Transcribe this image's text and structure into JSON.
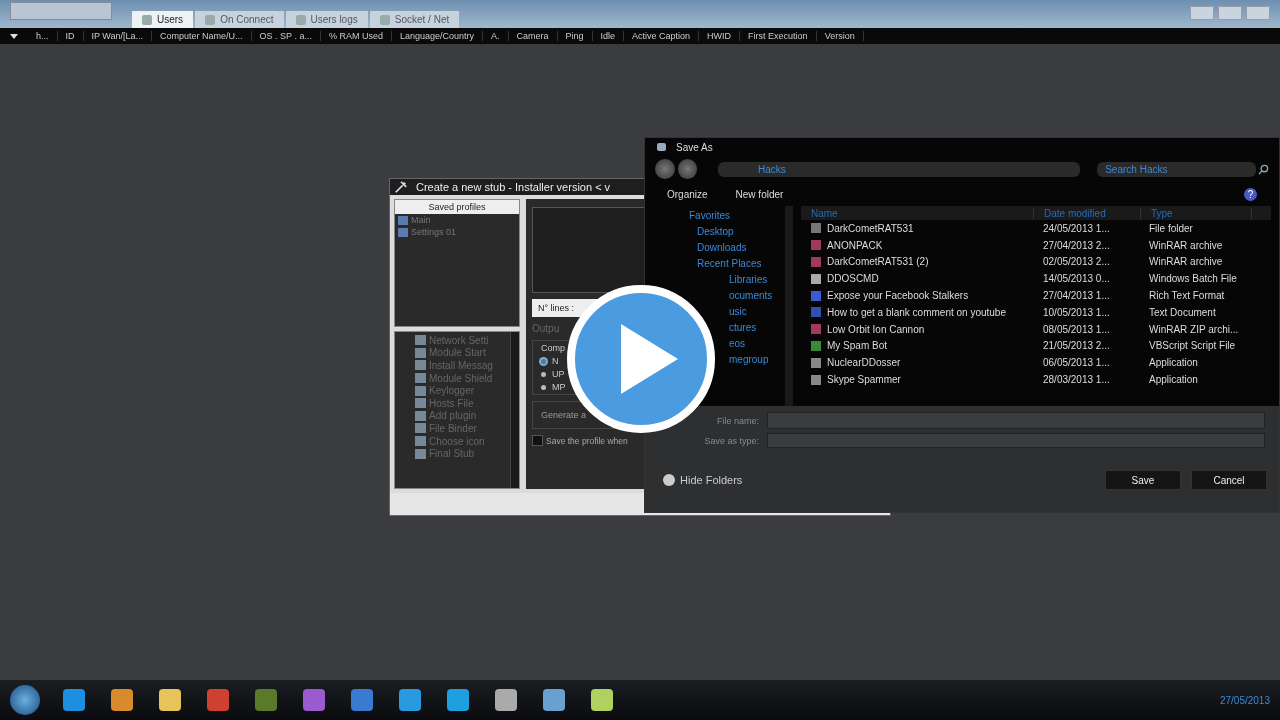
{
  "tabs": [
    {
      "label": "Users",
      "selected": true
    },
    {
      "label": "On Connect",
      "selected": false
    },
    {
      "label": "Users logs",
      "selected": false
    },
    {
      "label": "Socket / Net",
      "selected": false
    }
  ],
  "columns": [
    "h...",
    "ID",
    "IP Wan/[La...",
    "Computer Name/U...",
    "OS . SP . a...",
    "% RAM Used",
    "Language/Country",
    "A.",
    "Camera",
    "Ping",
    "Idle",
    "Active Caption",
    "HWID",
    "First Execution",
    "Version"
  ],
  "stub_window": {
    "title": "Create a new stub - Installer version < v",
    "saved_profiles_header": "Saved profiles",
    "profiles": [
      "Main",
      "Settings 01"
    ],
    "menu_items": [
      "Network Setti",
      "Module Start",
      "Install Messag",
      "Module Shield",
      "Keylogger",
      "Hosts File",
      "Add plugin",
      "File Binder",
      "Choose icon",
      "Final Stub"
    ],
    "lines_label": "N° lines :",
    "output_label": "Outpu",
    "compression_label": "Comp",
    "options": [
      {
        "label": "N",
        "selected": true
      },
      {
        "label": "UP",
        "selected": false
      },
      {
        "label": "MP",
        "selected": false
      }
    ],
    "generate_button": "Generate a",
    "save_profile": {
      "label": "Save the profile when",
      "checked": false
    }
  },
  "save_dialog": {
    "title": "Save As",
    "breadcrumb": "Hacks",
    "search_placeholder": "Search Hacks",
    "toolbar": [
      "Organize",
      "New folder"
    ],
    "help_label": "?",
    "nav": [
      {
        "label": "Favorites",
        "children": [
          {
            "label": "Desktop"
          },
          {
            "label": "Downloads"
          },
          {
            "label": "Recent Places"
          }
        ]
      },
      {
        "label": "Libraries",
        "children": [
          {
            "label": "ocuments"
          },
          {
            "label": "usic"
          },
          {
            "label": "ctures"
          },
          {
            "label": "eos"
          }
        ]
      },
      {
        "label": "megroup"
      }
    ],
    "columns": [
      "Name",
      "Date modified",
      "Type"
    ],
    "files": [
      {
        "name": "DarkCometRAT531",
        "date": "24/05/2013 1...",
        "type": "File folder",
        "kind": "folder"
      },
      {
        "name": "ANONPACK",
        "date": "27/04/2013 2...",
        "type": "WinRAR archive",
        "kind": "archive"
      },
      {
        "name": "DarkCometRAT531 (2)",
        "date": "02/05/2013 2...",
        "type": "WinRAR archive",
        "kind": "archive"
      },
      {
        "name": "DDOSCMD",
        "date": "14/05/2013 0...",
        "type": "Windows Batch File",
        "kind": "batch"
      },
      {
        "name": "Expose your Facebook Stalkers",
        "date": "27/04/2013 1...",
        "type": "Rich Text Format",
        "kind": "doc"
      },
      {
        "name": "How to get a blank comment on youtube",
        "date": "10/05/2013 1...",
        "type": "Text Document",
        "kind": "text"
      },
      {
        "name": "Low Orbit Ion Cannon",
        "date": "08/05/2013 1...",
        "type": "WinRAR ZIP archi...",
        "kind": "archive"
      },
      {
        "name": "My Spam Bot",
        "date": "21/05/2013 2...",
        "type": "VBScript Script File",
        "kind": "script"
      },
      {
        "name": "NuclearDDosser",
        "date": "06/05/2013 1...",
        "type": "Application",
        "kind": "app"
      },
      {
        "name": "Skype Spammer",
        "date": "28/03/2013 1...",
        "type": "Application",
        "kind": "app"
      }
    ],
    "file_name_label": "File name:",
    "save_type_label": "Save as type:",
    "hide_folders": "Hide Folders",
    "buttons": [
      "Save",
      "Cancel"
    ]
  },
  "taskbar": {
    "date": "27/05/2013"
  }
}
